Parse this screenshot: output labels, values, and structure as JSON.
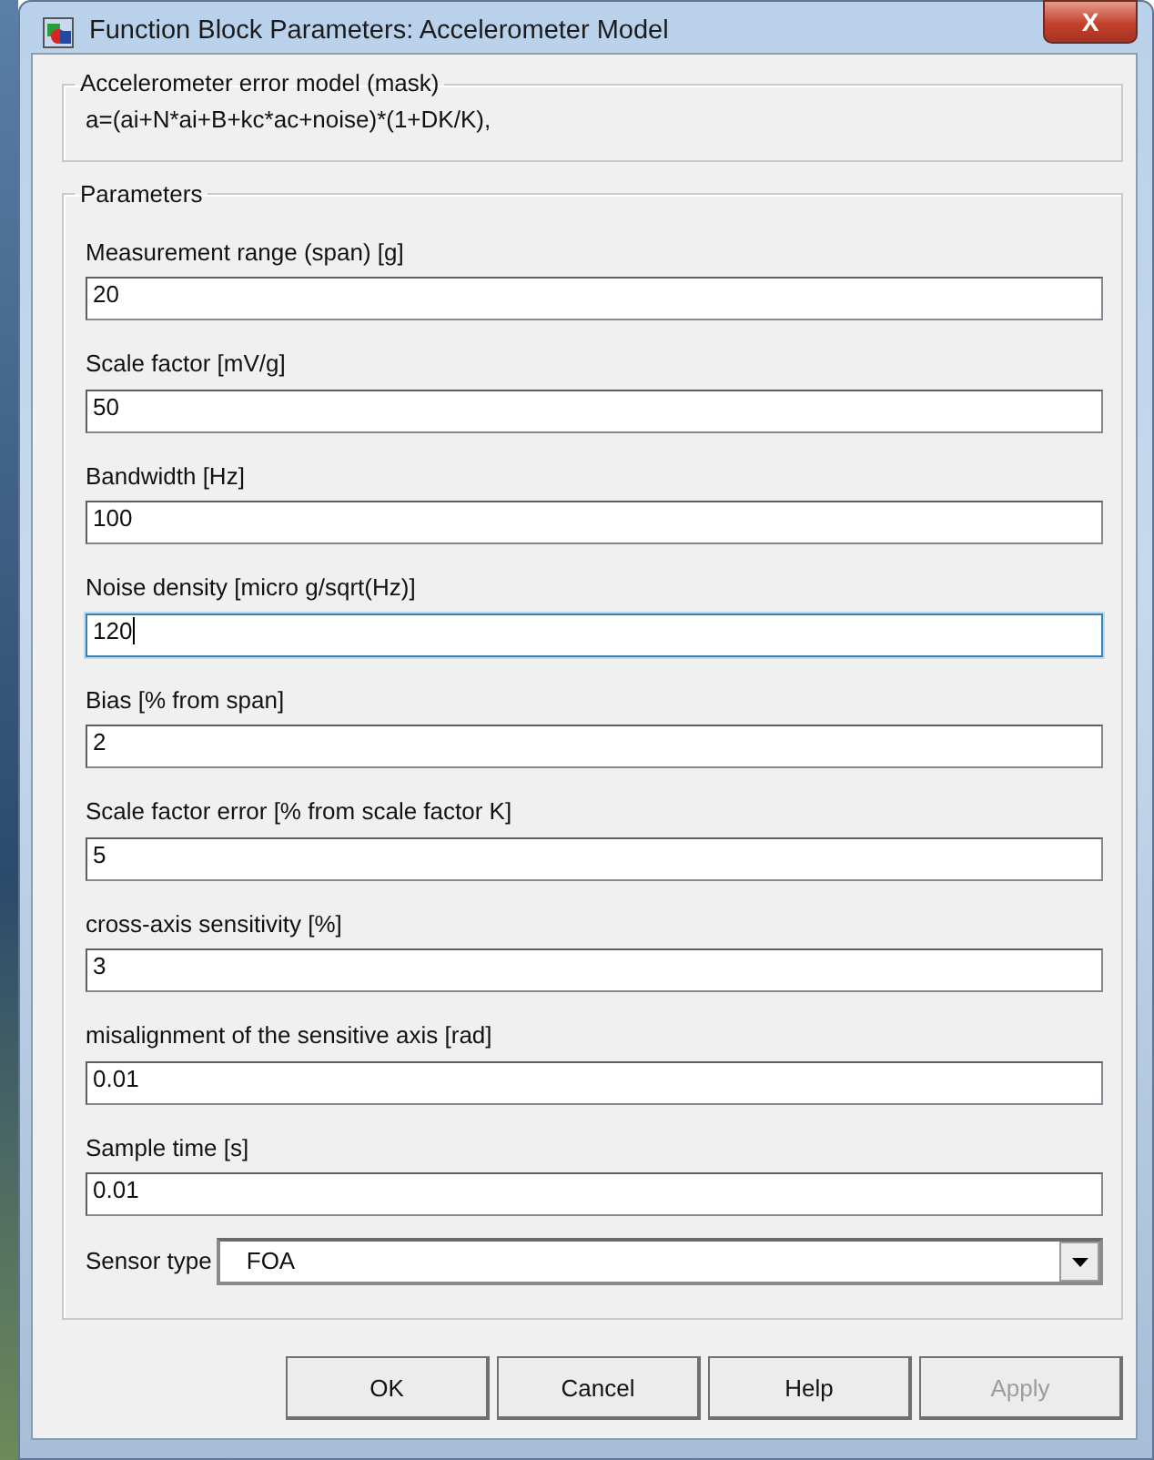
{
  "window": {
    "title": "Function Block Parameters: Accelerometer Model",
    "close_label": "X"
  },
  "description": {
    "legend": "Accelerometer error model (mask)",
    "text": "a=(ai+N*ai+B+kc*ac+noise)*(1+DK/K),"
  },
  "parameters": {
    "legend": "Parameters",
    "fields": [
      {
        "label": "Measurement range (span) [g]",
        "value": "20",
        "focused": false
      },
      {
        "label": "Scale factor [mV/g]",
        "value": "50",
        "focused": false
      },
      {
        "label": "Bandwidth  [Hz]",
        "value": "100",
        "focused": false
      },
      {
        "label": "Noise density [micro g/sqrt(Hz)]",
        "value": "120",
        "focused": true
      },
      {
        "label": "Bias [% from span]",
        "value": "2",
        "focused": false
      },
      {
        "label": "Scale factor error [% from scale factor K]",
        "value": "5",
        "focused": false
      },
      {
        "label": "cross-axis sensitivity [%]",
        "value": "3",
        "focused": false
      },
      {
        "label": "misalignment of the sensitive axis [rad]",
        "value": "0.01",
        "focused": false
      },
      {
        "label": "Sample time [s]",
        "value": "0.01",
        "focused": false
      }
    ],
    "sensor_type": {
      "label": "Sensor type",
      "value": "FOA"
    }
  },
  "buttons": [
    {
      "label": "OK",
      "disabled": false
    },
    {
      "label": "Cancel",
      "disabled": false
    },
    {
      "label": "Help",
      "disabled": false
    },
    {
      "label": "Apply",
      "disabled": true
    }
  ]
}
